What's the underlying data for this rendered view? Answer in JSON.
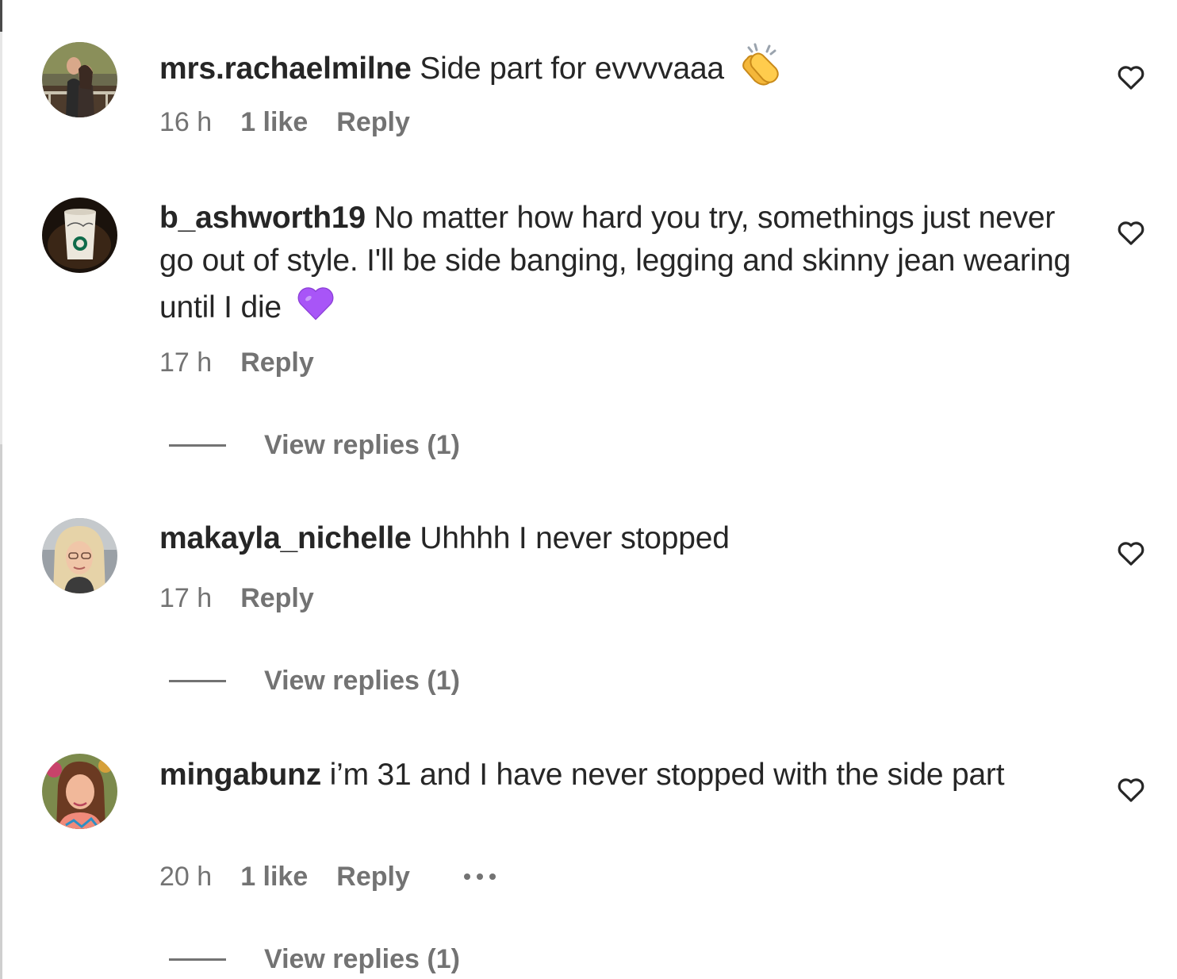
{
  "comments": [
    {
      "username": "mrs.rachaelmilne",
      "text": "Side part for evvvvaaa",
      "emoji": "clapping-hands",
      "time": "16 h",
      "likes": "1 like",
      "reply": "Reply"
    },
    {
      "username": "b_ashworth19",
      "text": "No matter how hard you try, somethings just never go out of style. I'll be side banging, legging and skinny jean wearing until I die",
      "emoji": "purple-heart",
      "time": "17 h",
      "reply": "Reply",
      "view_replies": "View replies (1)"
    },
    {
      "username": "makayla_nichelle",
      "text": "Uhhhh I never stopped",
      "time": "17 h",
      "reply": "Reply",
      "view_replies": "View replies (1)"
    },
    {
      "username": "mingabunz",
      "text": "i’m 31 and I have never stopped with the side part",
      "time": "20 h",
      "likes": "1 like",
      "reply": "Reply",
      "view_replies": "View replies (1)"
    }
  ],
  "colors": {
    "text": "#262626",
    "secondary": "#737373",
    "purple_heart": "#a855f7",
    "clap": "#f4b73a"
  }
}
